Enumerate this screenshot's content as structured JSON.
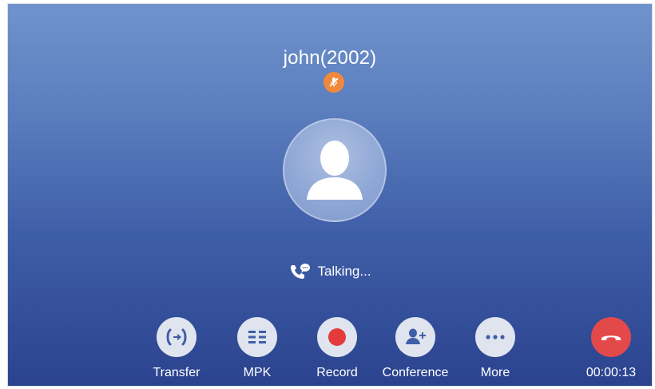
{
  "call": {
    "caller": "john(2002)",
    "status": "Talking...",
    "duration": "00:00:13"
  },
  "actions": [
    {
      "label": "Transfer",
      "icon": "transfer-icon"
    },
    {
      "label": "MPK",
      "icon": "mpk-icon"
    },
    {
      "label": "Record",
      "icon": "record-icon"
    },
    {
      "label": "Conference",
      "icon": "add-participant-icon"
    },
    {
      "label": "More",
      "icon": "more-icon"
    }
  ],
  "colors": {
    "background_top": "#6f93cc",
    "background_bottom": "#2b438f",
    "mute_badge": "#f0873b",
    "record": "#e53a3a",
    "hangup": "#e4494a",
    "button": "#dfe4ef"
  }
}
